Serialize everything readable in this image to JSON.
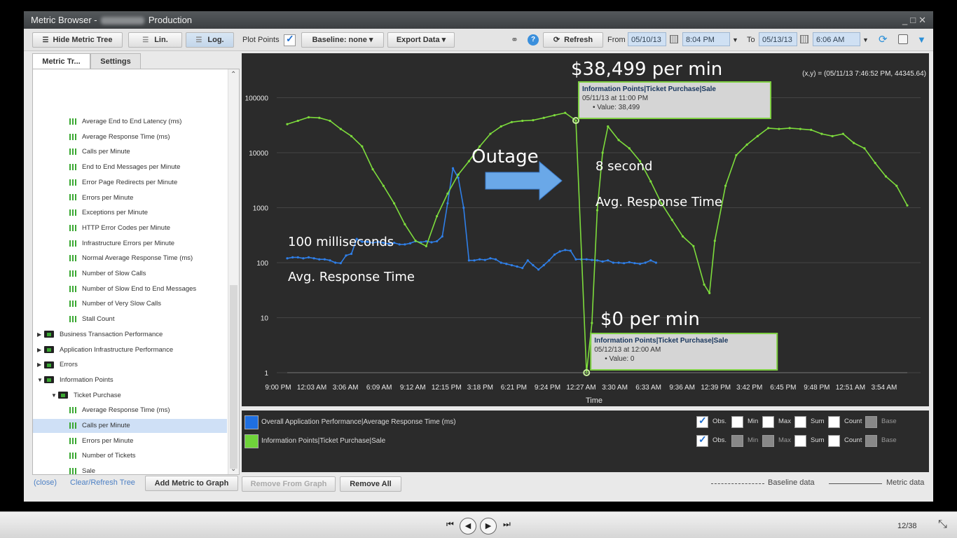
{
  "window": {
    "title_prefix": "Metric Browser -",
    "title_suffix": "Production",
    "ctl_min": "_",
    "ctl_max": "□",
    "ctl_close": "✕"
  },
  "toolbar": {
    "hide_tree": "Hide Metric Tree",
    "lin": "Lin.",
    "log": "Log.",
    "plot_points": "Plot Points",
    "baseline": "Baseline:  none",
    "export": "Export Data",
    "refresh": "Refresh",
    "from_label": "From",
    "from_date": "05/10/13",
    "from_time": "8:04 PM",
    "to_label": "To",
    "to_date": "05/13/13",
    "to_time": "6:06 AM"
  },
  "tabs": {
    "metric_tree": "Metric Tr...",
    "settings": "Settings"
  },
  "tree": {
    "items": [
      {
        "label": "Average End to End Latency (ms)",
        "kind": "metric",
        "level": 2
      },
      {
        "label": "Average Response Time (ms)",
        "kind": "metric",
        "level": 2
      },
      {
        "label": "Calls per Minute",
        "kind": "metric",
        "level": 2
      },
      {
        "label": "End to End Messages per Minute",
        "kind": "metric",
        "level": 2
      },
      {
        "label": "Error Page Redirects per Minute",
        "kind": "metric",
        "level": 2
      },
      {
        "label": "Errors per Minute",
        "kind": "metric",
        "level": 2
      },
      {
        "label": "Exceptions per Minute",
        "kind": "metric",
        "level": 2
      },
      {
        "label": "HTTP Error Codes per Minute",
        "kind": "metric",
        "level": 2
      },
      {
        "label": "Infrastructure Errors per Minute",
        "kind": "metric",
        "level": 2
      },
      {
        "label": "Normal Average Response Time (ms)",
        "kind": "metric",
        "level": 2
      },
      {
        "label": "Number of Slow Calls",
        "kind": "metric",
        "level": 2
      },
      {
        "label": "Number of Slow End to End Messages",
        "kind": "metric",
        "level": 2
      },
      {
        "label": "Number of Very Slow Calls",
        "kind": "metric",
        "level": 2
      },
      {
        "label": "Stall Count",
        "kind": "metric",
        "level": 2
      },
      {
        "label": "Business Transaction Performance",
        "kind": "folder",
        "level": 0,
        "expanded": false
      },
      {
        "label": "Application Infrastructure Performance",
        "kind": "folder",
        "level": 0,
        "expanded": false
      },
      {
        "label": "Errors",
        "kind": "folder",
        "level": 0,
        "expanded": false
      },
      {
        "label": "Information Points",
        "kind": "folder",
        "level": 0,
        "expanded": true
      },
      {
        "label": "Ticket Purchase",
        "kind": "folder",
        "level": 1,
        "expanded": true
      },
      {
        "label": "Average Response Time (ms)",
        "kind": "metric",
        "level": 3
      },
      {
        "label": "Calls per Minute",
        "kind": "metric",
        "level": 3,
        "selected": true
      },
      {
        "label": "Errors per Minute",
        "kind": "metric",
        "level": 3
      },
      {
        "label": "Number of Tickets",
        "kind": "metric",
        "level": 3
      },
      {
        "label": "Sale",
        "kind": "metric",
        "level": 3
      }
    ]
  },
  "tree_footer": {
    "close": "(close)",
    "clear": "Clear/Refresh Tree",
    "add": "Add Metric to Graph"
  },
  "chart_data": {
    "type": "line",
    "scale": "log",
    "ylim": [
      1,
      300000
    ],
    "yticks": [
      1,
      10,
      100,
      1000,
      10000,
      100000
    ],
    "ytick_labels": [
      "1",
      "10",
      "100",
      "1000",
      "10000",
      "100000"
    ],
    "xtick_labels": [
      "9:00 PM",
      "12:03 AM",
      "3:06 AM",
      "6:09 AM",
      "9:12 AM",
      "12:15 PM",
      "3:18 PM",
      "6:21 PM",
      "9:24 PM",
      "12:27 AM",
      "3:30 AM",
      "6:33 AM",
      "9:36 AM",
      "12:39 PM",
      "3:42 PM",
      "6:45 PM",
      "9:48 PM",
      "12:51 AM",
      "3:54 AM"
    ],
    "xlabel": "Time",
    "cursor_readout": "(x,y) = (05/11/13 7:46:52 PM, 44345.64)",
    "series": [
      {
        "name": "Overall Application Performance|Average Response Time (ms)",
        "color": "#2f7fe8",
        "points": [
          [
            0,
            120
          ],
          [
            0.5,
            125
          ],
          [
            1,
            125
          ],
          [
            1.5,
            120
          ],
          [
            2,
            125
          ],
          [
            2.5,
            120
          ],
          [
            3,
            115
          ],
          [
            3.5,
            115
          ],
          [
            4,
            110
          ],
          [
            4.5,
            100
          ],
          [
            5,
            98
          ],
          [
            5.5,
            135
          ],
          [
            6,
            145
          ],
          [
            6.5,
            270
          ],
          [
            7,
            240
          ],
          [
            7.5,
            240
          ],
          [
            8,
            230
          ],
          [
            8.5,
            240
          ],
          [
            9,
            230
          ],
          [
            9.5,
            220
          ],
          [
            10,
            230
          ],
          [
            10.5,
            215
          ],
          [
            11,
            215
          ],
          [
            11.5,
            225
          ],
          [
            12,
            245
          ],
          [
            12.5,
            235
          ],
          [
            13,
            245
          ],
          [
            13.5,
            235
          ],
          [
            14,
            245
          ],
          [
            14.5,
            300
          ],
          [
            15,
            1200
          ],
          [
            15.5,
            5200
          ],
          [
            16,
            3500
          ],
          [
            16.5,
            1000
          ],
          [
            17,
            110
          ],
          [
            17.5,
            110
          ],
          [
            18,
            115
          ],
          [
            18.5,
            112
          ],
          [
            19,
            120
          ],
          [
            19.5,
            115
          ],
          [
            20,
            100
          ],
          [
            20.5,
            95
          ],
          [
            21,
            90
          ],
          [
            21.5,
            85
          ],
          [
            22,
            80
          ],
          [
            22.5,
            110
          ],
          [
            23,
            90
          ],
          [
            23.5,
            75
          ],
          [
            24,
            90
          ],
          [
            24.5,
            110
          ],
          [
            25,
            140
          ],
          [
            25.5,
            160
          ],
          [
            26,
            170
          ],
          [
            26.5,
            165
          ],
          [
            27,
            115
          ],
          [
            27.5,
            115
          ],
          [
            28,
            115
          ],
          [
            28.5,
            112
          ],
          [
            29,
            110
          ],
          [
            29.5,
            105
          ],
          [
            30,
            110
          ],
          [
            30.5,
            100
          ],
          [
            31,
            100
          ],
          [
            31.5,
            98
          ],
          [
            32,
            102
          ],
          [
            32.5,
            98
          ],
          [
            33,
            95
          ],
          [
            33.5,
            100
          ],
          [
            34,
            110
          ],
          [
            34.5,
            100
          ]
        ]
      },
      {
        "name": "Information Points|Ticket Purchase|Sale",
        "color": "#7ddc3c",
        "points": [
          [
            0,
            33000
          ],
          [
            1,
            38000
          ],
          [
            2,
            44000
          ],
          [
            3,
            43000
          ],
          [
            4,
            38000
          ],
          [
            5,
            27000
          ],
          [
            6,
            20000
          ],
          [
            7,
            13000
          ],
          [
            8,
            5000
          ],
          [
            9,
            2500
          ],
          [
            10,
            1200
          ],
          [
            11,
            500
          ],
          [
            12,
            250
          ],
          [
            13,
            200
          ],
          [
            14,
            700
          ],
          [
            15,
            1800
          ],
          [
            16,
            4000
          ],
          [
            17,
            7000
          ],
          [
            18,
            13000
          ],
          [
            19,
            22000
          ],
          [
            20,
            30000
          ],
          [
            21,
            36000
          ],
          [
            22,
            38000
          ],
          [
            23,
            39000
          ],
          [
            24,
            43000
          ],
          [
            25,
            48000
          ],
          [
            26,
            53000
          ],
          [
            27,
            38499
          ],
          [
            28,
            1
          ],
          [
            28.5,
            8
          ],
          [
            29,
            900
          ],
          [
            29.5,
            10000
          ],
          [
            30,
            30000
          ],
          [
            31,
            17000
          ],
          [
            32,
            12000
          ],
          [
            33,
            7000
          ],
          [
            34,
            3000
          ],
          [
            35,
            1200
          ],
          [
            36,
            600
          ],
          [
            37,
            300
          ],
          [
            38,
            200
          ],
          [
            39,
            40
          ],
          [
            39.5,
            28
          ],
          [
            40,
            250
          ],
          [
            41,
            2500
          ],
          [
            42,
            9000
          ],
          [
            43,
            14000
          ],
          [
            44,
            20000
          ],
          [
            45,
            28000
          ],
          [
            46,
            27000
          ],
          [
            47,
            28000
          ],
          [
            48,
            27000
          ],
          [
            49,
            26000
          ],
          [
            50,
            22000
          ],
          [
            51,
            20000
          ],
          [
            52,
            22000
          ],
          [
            53,
            15000
          ],
          [
            54,
            12000
          ],
          [
            55,
            6500
          ],
          [
            56,
            3700
          ],
          [
            57,
            2500
          ],
          [
            58,
            1100
          ]
        ]
      },
      {
        "name": "baseline",
        "color": "#777777",
        "points": [
          [
            0,
            1
          ],
          [
            58,
            1
          ]
        ]
      }
    ],
    "x_domain": [
      0,
      58
    ],
    "markers": [
      {
        "x": 27,
        "y": 38499,
        "series": 1
      },
      {
        "x": 28,
        "y": 1,
        "series": 1
      }
    ],
    "tooltips": [
      {
        "title": "Information Points|Ticket Purchase|Sale",
        "when": "05/11/13 at 11:00 PM",
        "value": "Value: 38,499",
        "anchor": "top"
      },
      {
        "title": "Information Points|Ticket Purchase|Sale",
        "when": "05/12/13 at 12:00 AM",
        "value": "Value: 0",
        "anchor": "bottom"
      }
    ],
    "annotations": [
      {
        "text": "$38,499 per min",
        "size": "large"
      },
      {
        "text": "Outage",
        "size": "large"
      },
      {
        "text": "8 second",
        "size": "medium"
      },
      {
        "text": "Avg. Response Time",
        "size": "medium"
      },
      {
        "text": "100 milliseconds",
        "size": "medium"
      },
      {
        "text": "Avg. Response Time",
        "size": "medium"
      },
      {
        "text": "$0 per min",
        "size": "large"
      }
    ]
  },
  "legend": {
    "rows": [
      {
        "name": "Overall Application Performance|Average Response Time (ms)",
        "color": "#1f6fe0",
        "options": [
          [
            "Obs.",
            true,
            false
          ],
          [
            "Min",
            false,
            false
          ],
          [
            "Max",
            false,
            false
          ],
          [
            "Sum",
            false,
            false
          ],
          [
            "Count",
            false,
            false
          ],
          [
            "Base",
            false,
            true
          ]
        ]
      },
      {
        "name": "Information Points|Ticket Purchase|Sale",
        "color": "#6fd33a",
        "options": [
          [
            "Obs.",
            true,
            false
          ],
          [
            "Min",
            false,
            true
          ],
          [
            "Max",
            false,
            true
          ],
          [
            "Sum",
            false,
            false
          ],
          [
            "Count",
            false,
            false
          ],
          [
            "Base",
            false,
            true
          ]
        ]
      }
    ]
  },
  "graph_footer": {
    "remove": "Remove From Graph",
    "remove_all": "Remove All",
    "baseline": "Baseline data",
    "metric": "Metric data"
  },
  "slideshow": {
    "counter": "12/38"
  }
}
